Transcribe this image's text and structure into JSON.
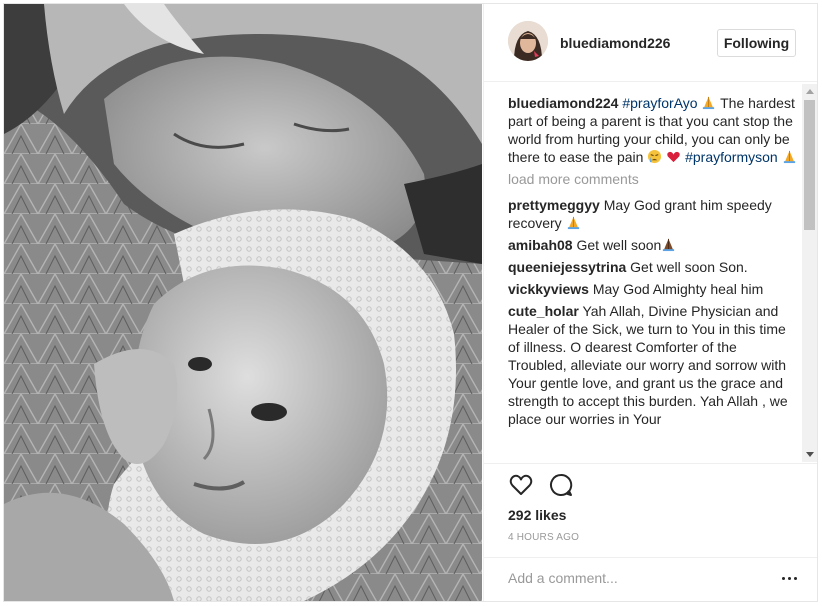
{
  "post": {
    "author": {
      "username": "bluediamond226",
      "follow_label": "Following"
    },
    "caption": {
      "username": "bluediamond224",
      "hashtag_1": "#prayforAyo",
      "text": "The hardest part of being a parent is that you cant stop the world from hurting your child, you can only be there to ease the pain",
      "hashtag_2": "#prayformyson",
      "emojis": [
        "praying-hands",
        "crying-face",
        "red-heart",
        "praying-hands"
      ]
    },
    "load_more_label": "load more comments",
    "comments": [
      {
        "username": "prettymeggyy",
        "text": "May God grant him speedy recovery",
        "emoji": "praying-hands"
      },
      {
        "username": "amibah08",
        "text": "Get well soon",
        "emoji": "praying-hands"
      },
      {
        "username": "queeniejessytrina",
        "text": "Get well soon Son.",
        "emoji": ""
      },
      {
        "username": "vickkyviews",
        "text": "May God Almighty heal him",
        "emoji": ""
      },
      {
        "username": "cute_holar",
        "text": "Yah Allah, Divine Physician and Healer of the Sick, we turn to You in this time of illness. O dearest Comforter of the Troubled, alleviate our worry and sorrow with Your gentle love, and grant us the grace and strength to accept this burden. Yah Allah , we place our worries in Your",
        "emoji": ""
      }
    ],
    "likes": "292 likes",
    "timestamp": "4 HOURS AGO",
    "add_comment_placeholder": "Add a comment...",
    "icons": {
      "like": "heart-outline-icon",
      "comment": "comment-bubble-icon",
      "more": "more-options-icon"
    },
    "colors": {
      "hashtag": "#003569",
      "text": "#262626",
      "muted": "#999999",
      "border": "#efefef"
    }
  }
}
